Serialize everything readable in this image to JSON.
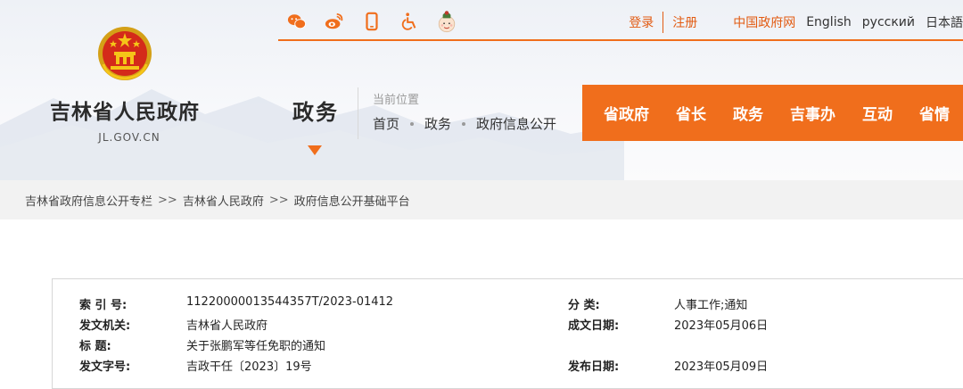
{
  "site": {
    "title": "吉林省人民政府",
    "domain": "JL.GOV.CN"
  },
  "top_icons": [
    "wechat-icon",
    "weibo-icon",
    "mobile-icon",
    "accessibility-icon",
    "elder-mode-icon"
  ],
  "account": {
    "login": "登录",
    "register": "注册"
  },
  "languages": [
    "中国政府网",
    "English",
    "русский",
    "日本語"
  ],
  "section": {
    "label": "政务"
  },
  "location": {
    "title": "当前位置",
    "path": [
      "首页",
      "政务",
      "政府信息公开"
    ]
  },
  "main_nav": [
    "省政府",
    "省长",
    "政务",
    "吉事办",
    "互动",
    "省情"
  ],
  "breadcrumb": {
    "items": [
      "吉林省政府信息公开专栏",
      "吉林省人民政府",
      "政府信息公开基础平台"
    ],
    "separator": ">>"
  },
  "info": {
    "rows": [
      {
        "label1": "索 引 号:",
        "value1": "11220000013544357T/2023-01412",
        "label2": "分    类:",
        "value2": "人事工作;通知"
      },
      {
        "label1": "发文机关:",
        "value1": "吉林省人民政府",
        "label2": "成文日期:",
        "value2": "2023年05月06日"
      },
      {
        "label1": "标      题:",
        "value1": "关于张鹏军等任免职的通知",
        "label2": "",
        "value2": ""
      },
      {
        "label1": "发文字号:",
        "value1": "吉政干任〔2023〕19号",
        "label2": "发布日期:",
        "value2": "2023年05月09日"
      }
    ]
  },
  "colors": {
    "accent": "#f06e1c",
    "link": "#e25b12",
    "breadcrumb_bg": "#f2f2f2"
  }
}
